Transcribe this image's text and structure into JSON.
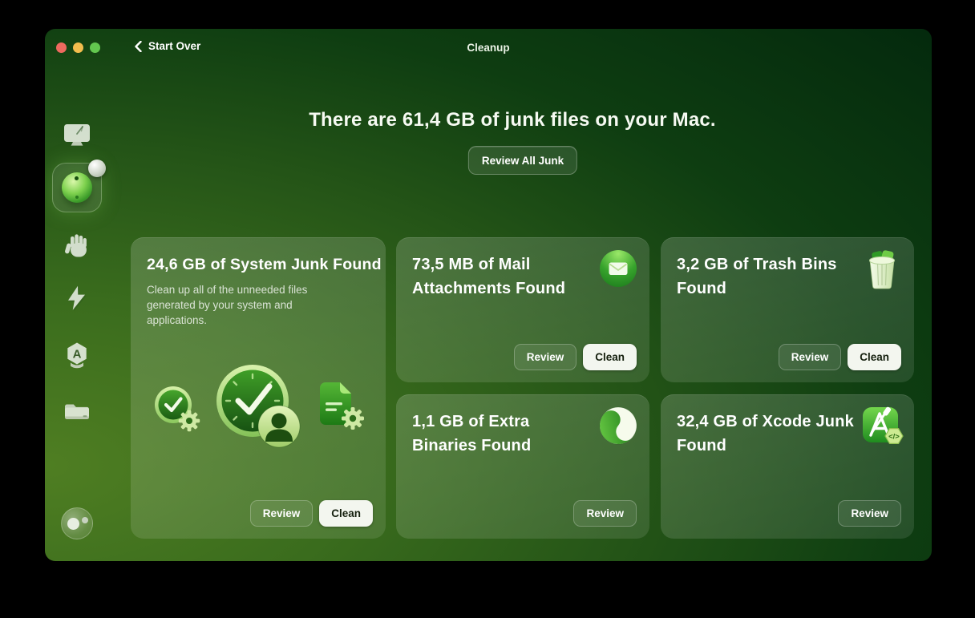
{
  "colors": {
    "traffic_red": "#ee6a5f",
    "traffic_yellow": "#f3bd4e",
    "traffic_green": "#63c74f",
    "clean_button_bg": "#f3f6ef",
    "clean_button_text": "#15200e",
    "window_green_bright": "#4f7e22",
    "window_green_dark": "#042a0d"
  },
  "titlebar": {
    "back_label": "Start Over",
    "title": "Cleanup"
  },
  "sidebar": {
    "icons": [
      "imac-icon",
      "cleanup-sphere-icon",
      "hand-icon",
      "lightning-icon",
      "app-badge-icon",
      "folder-icon"
    ],
    "selected": "cleanup-sphere-icon",
    "footer_icon": "assistant-orb-icon"
  },
  "main": {
    "heading": "There are 61,4 GB of junk files on your Mac.",
    "review_all_label": "Review All Junk",
    "cards": [
      {
        "title": "24,6 GB of System Junk Found",
        "description": "Clean up all of the unneeded files generated by your system and applications.",
        "review_label": "Review",
        "clean_label": "Clean",
        "icons": [
          "clock-check-gear-icon",
          "clock-check-person-icon",
          "document-gear-icon"
        ]
      },
      {
        "title": "73,5 MB of Mail Attachments Found",
        "review_label": "Review",
        "clean_label": "Clean",
        "icon": "mail-icon"
      },
      {
        "title": "3,2 GB of Trash Bins Found",
        "review_label": "Review",
        "clean_label": "Clean",
        "icon": "trash-bin-icon"
      },
      {
        "title": "1,1 GB of Extra Binaries Found",
        "review_label": "Review",
        "icon": "binaries-swirl-icon"
      },
      {
        "title": "32,4 GB of Xcode Junk Found",
        "review_label": "Review",
        "icon": "xcode-icon",
        "badge": "</>"
      }
    ]
  }
}
